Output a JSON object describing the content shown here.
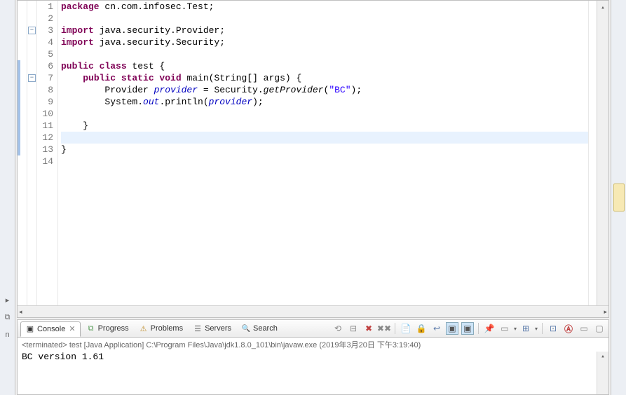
{
  "editor": {
    "lines": [
      {
        "n": 1,
        "segments": [
          {
            "t": "package ",
            "c": "kw"
          },
          {
            "t": "cn.com.infosec.Test;",
            "c": "pkg"
          }
        ]
      },
      {
        "n": 2,
        "segments": []
      },
      {
        "n": 3,
        "segments": [
          {
            "t": "import ",
            "c": "kw"
          },
          {
            "t": "java.security.Provider;",
            "c": "pkg"
          }
        ],
        "fold": "minus"
      },
      {
        "n": 4,
        "segments": [
          {
            "t": "import ",
            "c": "kw"
          },
          {
            "t": "java.security.Security;",
            "c": "pkg"
          }
        ]
      },
      {
        "n": 5,
        "segments": []
      },
      {
        "n": 6,
        "segments": [
          {
            "t": "public class ",
            "c": "kw"
          },
          {
            "t": "test {",
            "c": "type"
          }
        ]
      },
      {
        "n": 7,
        "segments": [
          {
            "t": "    ",
            "c": ""
          },
          {
            "t": "public static void ",
            "c": "kw"
          },
          {
            "t": "main(String[] args) {",
            "c": "type"
          }
        ],
        "fold": "minus"
      },
      {
        "n": 8,
        "segments": [
          {
            "t": "        Provider ",
            "c": "type"
          },
          {
            "t": "provider",
            "c": "field"
          },
          {
            "t": " = Security.",
            "c": "type"
          },
          {
            "t": "getProvider",
            "c": "method-italic"
          },
          {
            "t": "(",
            "c": ""
          },
          {
            "t": "\"BC\"",
            "c": "str"
          },
          {
            "t": ");",
            "c": ""
          }
        ]
      },
      {
        "n": 9,
        "segments": [
          {
            "t": "        System.",
            "c": "type"
          },
          {
            "t": "out",
            "c": "field"
          },
          {
            "t": ".println(",
            "c": "type"
          },
          {
            "t": "provider",
            "c": "field"
          },
          {
            "t": ");",
            "c": "type"
          }
        ]
      },
      {
        "n": 10,
        "segments": []
      },
      {
        "n": 11,
        "segments": [
          {
            "t": "    }",
            "c": "type"
          }
        ]
      },
      {
        "n": 12,
        "segments": [],
        "highlight": true
      },
      {
        "n": 13,
        "segments": [
          {
            "t": "}",
            "c": "type"
          }
        ]
      },
      {
        "n": 14,
        "segments": []
      }
    ],
    "blue_markers": [
      6,
      7,
      8,
      9,
      10,
      11,
      12,
      13
    ]
  },
  "tabs": {
    "console": "Console",
    "progress": "Progress",
    "problems": "Problems",
    "servers": "Servers",
    "search": "Search"
  },
  "console": {
    "header": "<terminated> test [Java Application] C:\\Program Files\\Java\\jdk1.8.0_101\\bin\\javaw.exe (2019年3月20日 下午3:19:40)",
    "output": "BC version 1.61"
  },
  "icons": {
    "console": "▣",
    "progress": "⧉",
    "problems": "⚠",
    "servers": "☰",
    "search": "🔍"
  }
}
